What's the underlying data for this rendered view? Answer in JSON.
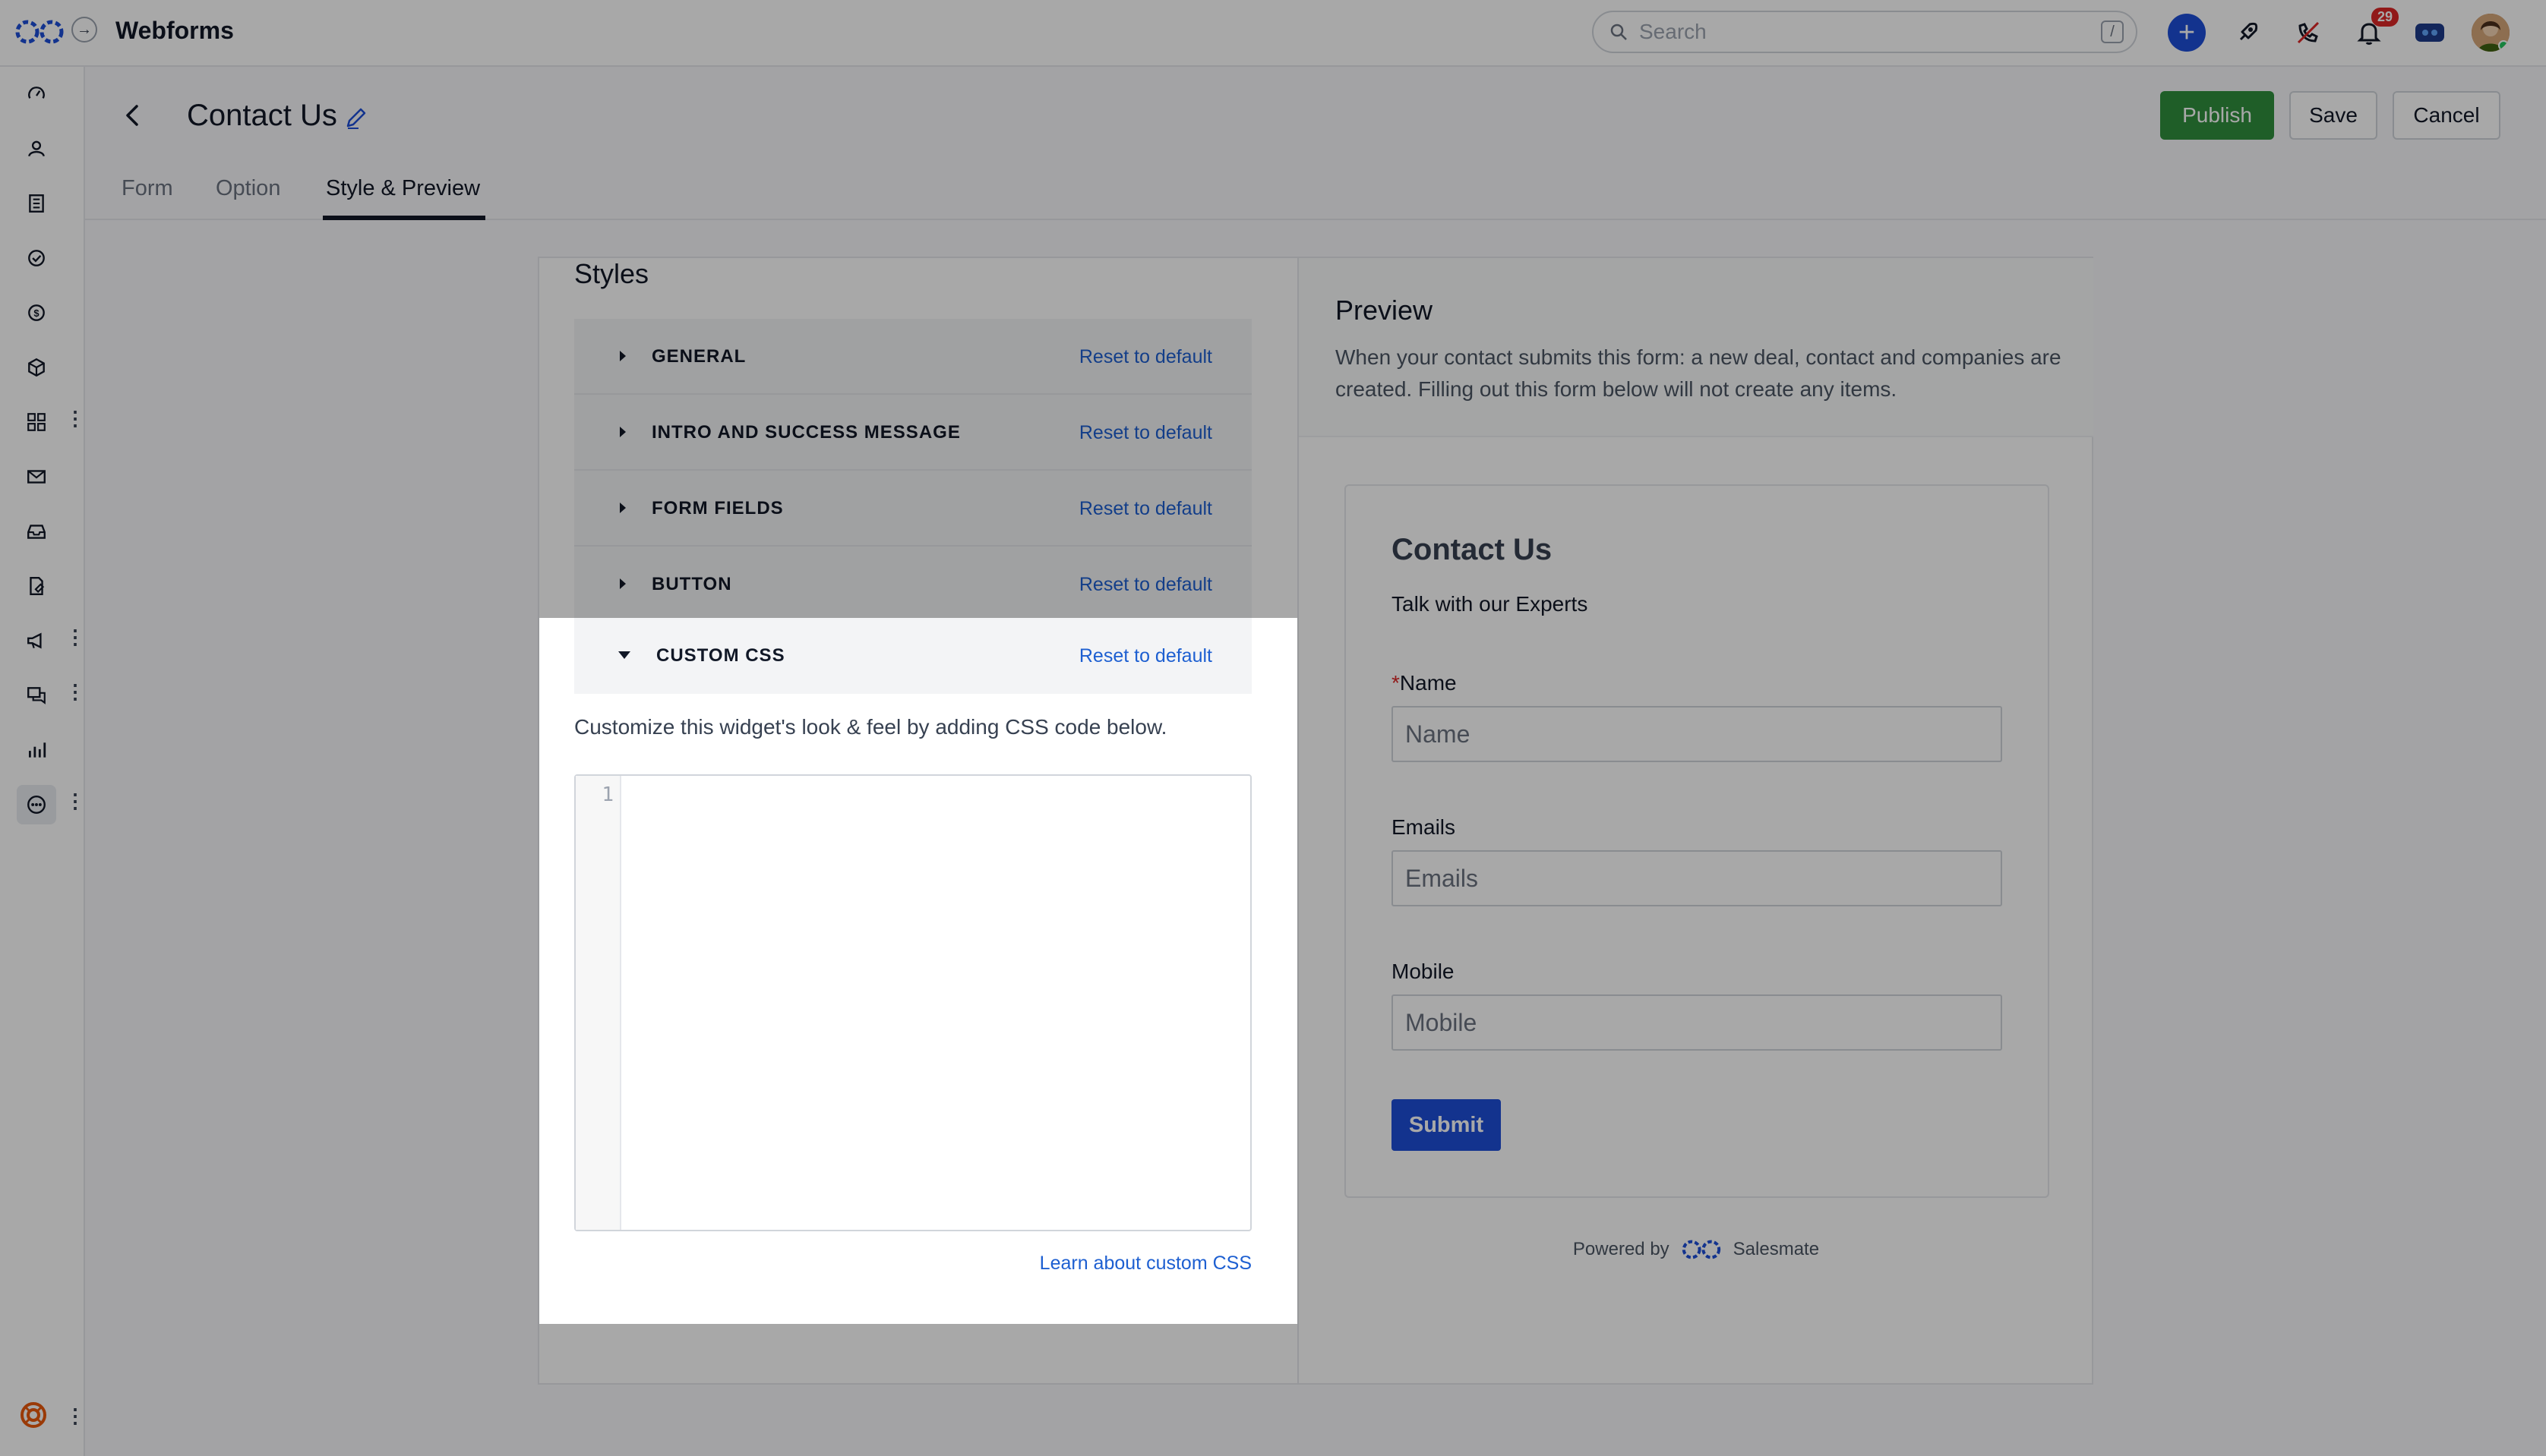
{
  "app": {
    "title": "Webforms"
  },
  "search": {
    "placeholder": "Search",
    "shortcut": "/"
  },
  "topbar": {
    "notification_count": "29"
  },
  "page": {
    "title": "Contact Us"
  },
  "actions": {
    "publish": "Publish",
    "save": "Save",
    "cancel": "Cancel"
  },
  "tabs": [
    {
      "label": "Form"
    },
    {
      "label": "Option"
    },
    {
      "label": "Style & Preview",
      "active": true
    }
  ],
  "styles": {
    "title": "Styles",
    "sections": [
      {
        "label": "GENERAL",
        "reset": "Reset to default"
      },
      {
        "label": "INTRO AND SUCCESS MESSAGE",
        "reset": "Reset to default"
      },
      {
        "label": "FORM FIELDS",
        "reset": "Reset to default"
      },
      {
        "label": "BUTTON",
        "reset": "Reset to default"
      }
    ],
    "custom_css": {
      "label": "CUSTOM CSS",
      "reset": "Reset to default",
      "description": "Customize this widget's look & feel by adding CSS code below.",
      "line_number": "1",
      "value": "",
      "learn_link": "Learn about custom CSS"
    }
  },
  "preview": {
    "title": "Preview",
    "description": "When your contact submits this form: a new deal, contact and companies are created. Filling out this form below will not create any items.",
    "form": {
      "title": "Contact Us",
      "subtitle": "Talk with our Experts",
      "fields": [
        {
          "label": "Name",
          "required_mark": "*",
          "placeholder": "Name"
        },
        {
          "label": "Emails",
          "placeholder": "Emails"
        },
        {
          "label": "Mobile",
          "placeholder": "Mobile"
        }
      ],
      "submit": "Submit"
    },
    "powered_by": "Powered by",
    "brand": "Salesmate"
  },
  "colors": {
    "accent": "#1d4ed8",
    "publish": "#2f8f3e",
    "link": "#1d5fd1"
  },
  "icons": {
    "rail": [
      "dashboard-icon",
      "contacts-icon",
      "companies-icon",
      "tasks-icon",
      "deals-icon",
      "products-icon",
      "apps-icon",
      "email-icon",
      "inbox-icon",
      "documents-icon",
      "campaigns-icon",
      "conversations-icon",
      "reports-icon",
      "more-icon"
    ],
    "top": [
      "add-icon",
      "rocket-icon",
      "phone-icon",
      "bell-icon",
      "chat-bot-icon",
      "avatar"
    ]
  }
}
